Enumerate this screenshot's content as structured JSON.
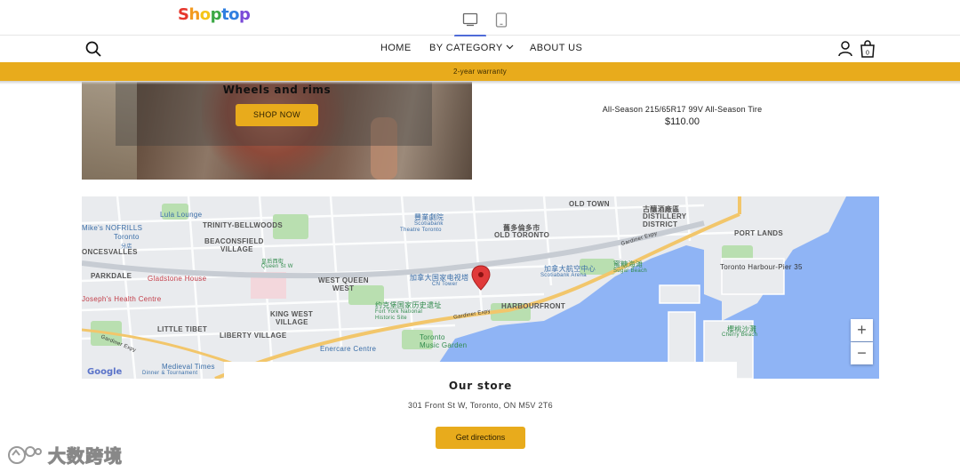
{
  "logo": {
    "letters": [
      {
        "ch": "S",
        "color": "#e6372d"
      },
      {
        "ch": "h",
        "color": "#f39a1e"
      },
      {
        "ch": "o",
        "color": "#f5c518"
      },
      {
        "ch": "p",
        "color": "#3ba845"
      },
      {
        "ch": "t",
        "color": "#2f7fe0"
      },
      {
        "ch": "o",
        "color": "#2f7fe0"
      },
      {
        "ch": "p",
        "color": "#7a4ad8"
      }
    ]
  },
  "editor": {
    "devices": [
      "desktop-icon",
      "tablet-icon"
    ],
    "active": "desktop"
  },
  "nav": {
    "home": "HOME",
    "category": "BY CATEGORY",
    "about": "ABOUT US",
    "cart_count": "0"
  },
  "announcement": "2-year warranty",
  "hero": {
    "title": "Wheels and rims",
    "button": "SHOP NOW"
  },
  "product": {
    "name": "All-Season 215/65R17 99V All-Season Tire",
    "price": "$110.00"
  },
  "map": {
    "labels": {
      "lula": "Lula Lounge",
      "nofrills": "Mike's NOFRILLS",
      "nofrills2": "Toronto",
      "nofrills3": "分店",
      "trinity": "TRINITY-BELLWOODS",
      "beaconsfield": "BEACONSFIELD",
      "beaconsfield2": "VILLAGE",
      "roncesvalles": "ONCESVALLES",
      "parkdale": "PARKDALE",
      "gladstone": "Gladstone House",
      "josephs": "Joseph's Health Centre",
      "queenst": "皇后西街",
      "queenst2": "Queen St W",
      "westqueen": "WEST QUEEN",
      "westqueen2": "WEST",
      "kingwest": "KING WEST",
      "kingwest2": "VILLAGE",
      "littletibet": "LITTLE TIBET",
      "liberty": "LIBERTY VILLAGE",
      "medieval": "Medieval Times",
      "medieval2": "Dinner & Tournament",
      "enercare": "Enercare Centre",
      "fortyork": "约克堡国家历史遗址",
      "fortyork2": "Fort York National",
      "fortyork3": "Historic Site",
      "music": "Toronto",
      "music2": "Music Garden",
      "cntower": "加拿大国家电视塔",
      "cntower2": "CN Tower",
      "scotiabank": "加拿大航空中心",
      "scotiabank2": "Scotiabank Arena",
      "theatre": "豐業劇院",
      "theatre2": "Scotiabank",
      "theatre3": "Theatre Toronto",
      "oldtown": "OLD TOWN",
      "oldtoronto": "OLD TORONTO",
      "oldtoronto_cn": "舊多倫多市",
      "distillery_cn": "古釀酒廠區",
      "distillery": "DISTILLERY",
      "distillery2": "DISTRICT",
      "portlands": "PORT LANDS",
      "harbourfront": "HARBOURFRONT",
      "sugar": "蜜糖海滩",
      "sugar2": "Sugar Beach",
      "pier": "Toronto Harbour-Pier 35",
      "cherry": "櫻桃沙灘",
      "cherry2": "Cherry Beach",
      "gardiner": "Gardiner Expy",
      "gardiner2": "Gardiner Expy",
      "gardiner3": "Gardiner Expy"
    },
    "google": "Google",
    "zoom_in": "+",
    "zoom_out": "−"
  },
  "store": {
    "title": "Our store",
    "address": "301 Front St W, Toronto, ON M5V 2T6",
    "button": "Get directions"
  },
  "watermark": "大数跨境",
  "colors": {
    "accent": "#e8ab1c",
    "active_tab": "#4f6bd8",
    "water": "#8fb4f5",
    "park": "#b9dfb0",
    "highway": "#f2c66b",
    "pin": "#e03a3a"
  }
}
